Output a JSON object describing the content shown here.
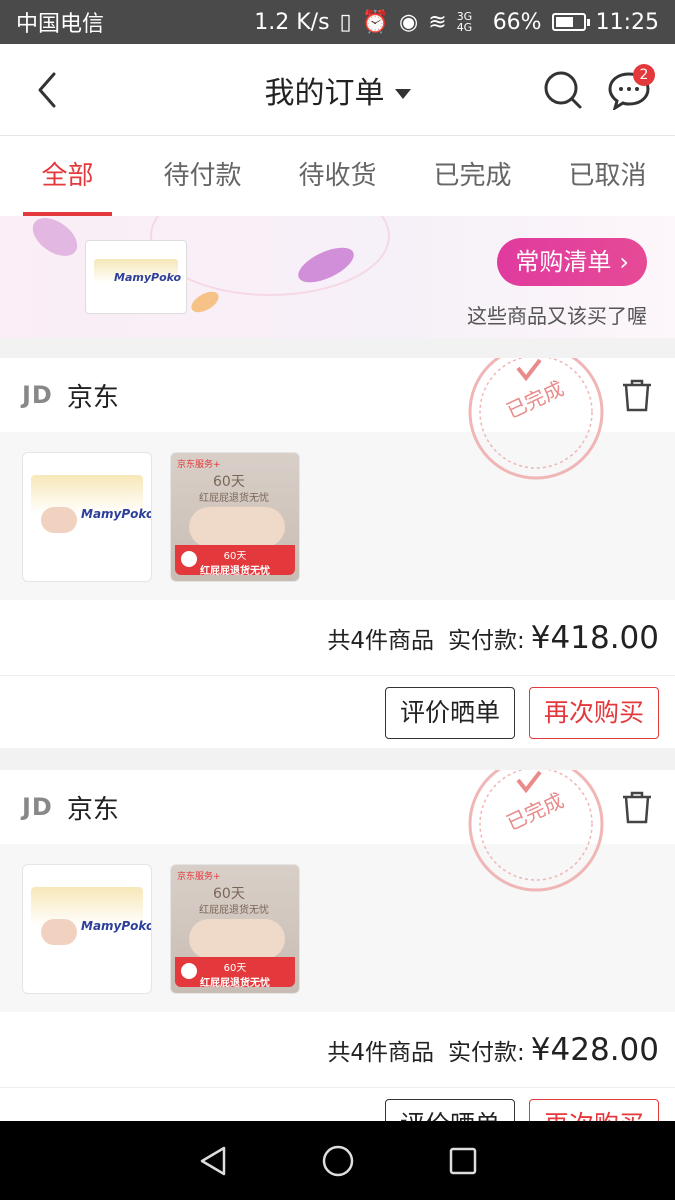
{
  "status_bar": {
    "carrier": "中国电信",
    "speed": "1.2 K/s",
    "network": "3G 4G",
    "battery": "66%",
    "battery_level": 0.66,
    "time": "11:25"
  },
  "nav": {
    "title": "我的订单",
    "message_badge": "2"
  },
  "tabs": [
    {
      "label": "全部",
      "active": true
    },
    {
      "label": "待付款",
      "active": false
    },
    {
      "label": "待收货",
      "active": false
    },
    {
      "label": "已完成",
      "active": false
    },
    {
      "label": "已取消",
      "active": false
    }
  ],
  "banner": {
    "cta_label": "常购清单",
    "subtitle": "这些商品又该买了喔",
    "product_brand": "MamyPoko"
  },
  "orders": [
    {
      "shop_logo": "JD",
      "shop_name": "京东",
      "status_stamp": "已完成",
      "items": [
        {
          "type": "diaper",
          "brand": "MamyPoko"
        },
        {
          "type": "service",
          "header": "京东服务+",
          "title": "60天",
          "subtitle": "红屁屁退货无忧",
          "band_line1": "60天",
          "band_line2": "红屁屁退货无忧"
        }
      ],
      "count_text": "共4件商品",
      "pay_label": "实付款:",
      "amount": "¥418.00",
      "buttons": {
        "review": "评价晒单",
        "rebuy": "再次购买"
      }
    },
    {
      "shop_logo": "JD",
      "shop_name": "京东",
      "status_stamp": "已完成",
      "items": [
        {
          "type": "diaper",
          "brand": "MamyPoko"
        },
        {
          "type": "service",
          "header": "京东服务+",
          "title": "60天",
          "subtitle": "红屁屁退货无忧",
          "band_line1": "60天",
          "band_line2": "红屁屁退货无忧"
        }
      ],
      "count_text": "共4件商品",
      "pay_label": "实付款:",
      "amount": "¥428.00",
      "buttons": {
        "review": "评价晒单",
        "rebuy": "再次购买"
      }
    }
  ],
  "colors": {
    "accent": "#e4393c",
    "cta_gradient_start": "#e03a9f",
    "status_bar": "#4a4a4a"
  },
  "icons": [
    "back-arrow-icon",
    "dropdown-caret-icon",
    "search-icon",
    "message-icon",
    "trash-icon",
    "back-nav-icon",
    "home-nav-icon",
    "recents-nav-icon"
  ]
}
